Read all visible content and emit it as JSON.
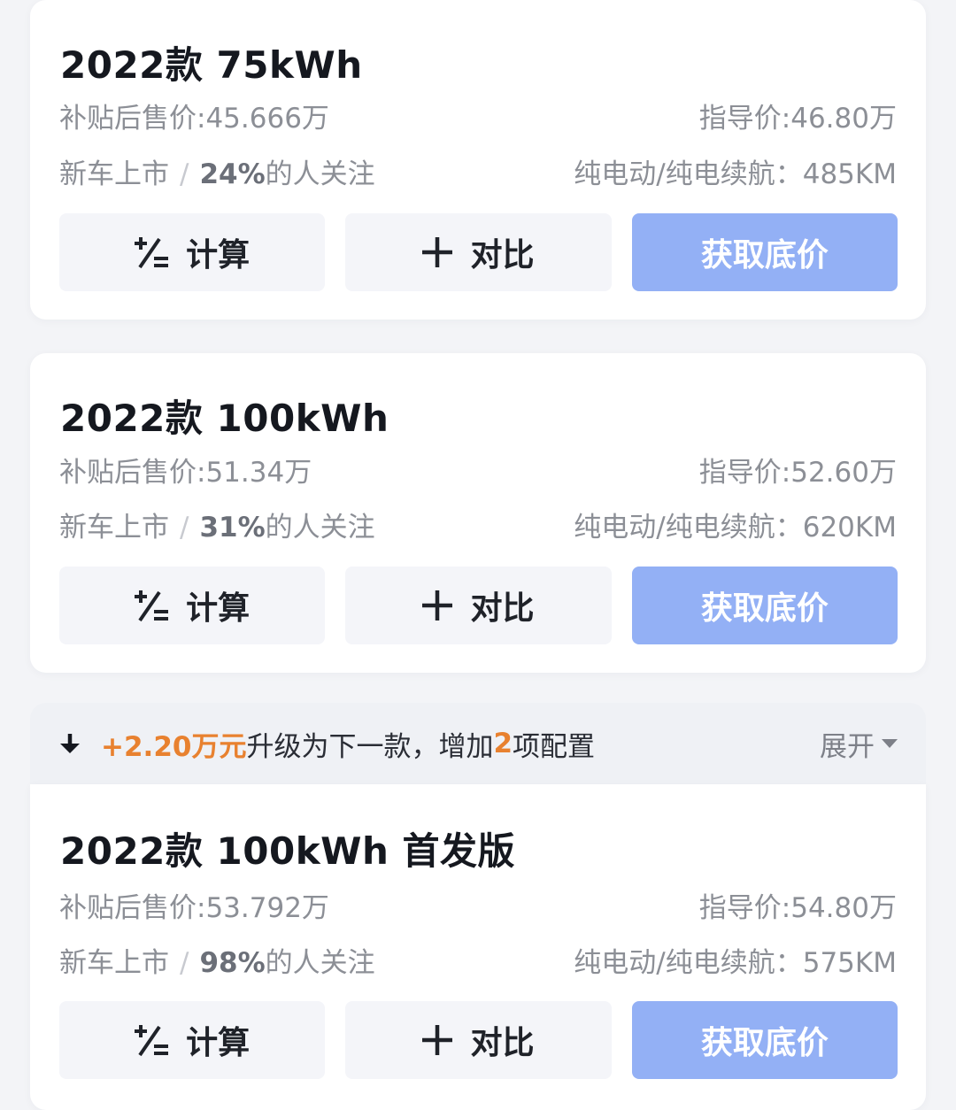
{
  "cards": [
    {
      "title": "2022款 75kWh",
      "subsidy_price": "补贴后售价:45.666万",
      "guide_price": "指导价:46.80万",
      "status": "新车上市",
      "attention_pct": "24%",
      "attention_suffix": "的人关注",
      "range": "纯电动/纯电续航：485KM"
    },
    {
      "title": "2022款 100kWh",
      "subsidy_price": "补贴后售价:51.34万",
      "guide_price": "指导价:52.60万",
      "status": "新车上市",
      "attention_pct": "31%",
      "attention_suffix": "的人关注",
      "range": "纯电动/纯电续航：620KM"
    },
    {
      "title": "2022款 100kWh 首发版",
      "subsidy_price": "补贴后售价:53.792万",
      "guide_price": "指导价:54.80万",
      "status": "新车上市",
      "attention_pct": "98%",
      "attention_suffix": "的人关注",
      "range": "纯电动/纯电续航：575KM"
    }
  ],
  "separator": "/",
  "buttons": {
    "calculate": "计算",
    "compare": "对比",
    "get_price": "获取底价"
  },
  "upgrade_bar": {
    "price_diff": "+2.20万元",
    "text_middle": "升级为下一款，增加",
    "count": "2",
    "text_end": "项配置",
    "expand": "展开"
  },
  "colors": {
    "primary_button": "#93b0f5",
    "highlight": "#e8812f"
  }
}
